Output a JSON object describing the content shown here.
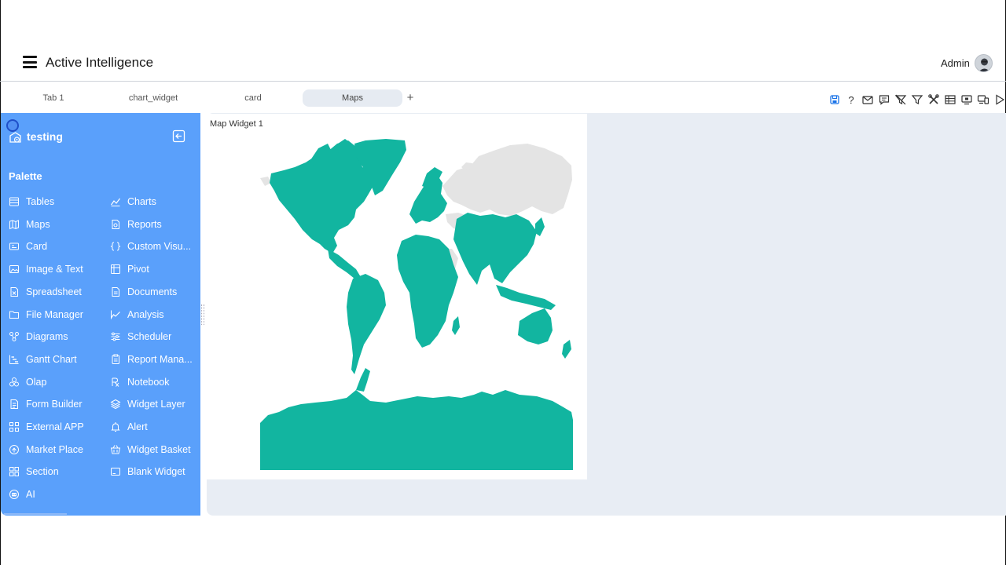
{
  "app": {
    "title": "Active Intelligence",
    "user": "Admin"
  },
  "tabs": [
    {
      "label": "Tab 1",
      "active": false
    },
    {
      "label": "chart_widget",
      "active": false
    },
    {
      "label": "card",
      "active": false
    },
    {
      "label": "Maps",
      "active": true
    }
  ],
  "tab_add_label": "+",
  "toolbar": {
    "icons": [
      "save-icon",
      "help-icon",
      "mail-icon",
      "comment-icon",
      "filter-clear-icon",
      "filter-icon",
      "tools-icon",
      "table-icon",
      "monitor-icon",
      "devices-icon",
      "play-icon"
    ],
    "help_glyph": "?"
  },
  "sidebar": {
    "workspace_name": "testing",
    "palette_title": "Palette",
    "items": [
      {
        "label": "Tables",
        "icon": "table-icon"
      },
      {
        "label": "Charts",
        "icon": "chart-icon"
      },
      {
        "label": "Maps",
        "icon": "map-icon"
      },
      {
        "label": "Reports",
        "icon": "report-icon"
      },
      {
        "label": "Card",
        "icon": "card-icon"
      },
      {
        "label": "Custom Visu...",
        "icon": "braces-icon"
      },
      {
        "label": "Image & Text",
        "icon": "image-icon"
      },
      {
        "label": "Pivot",
        "icon": "pivot-icon"
      },
      {
        "label": "Spreadsheet",
        "icon": "spreadsheet-icon"
      },
      {
        "label": "Documents",
        "icon": "document-icon"
      },
      {
        "label": "File Manager",
        "icon": "folder-icon"
      },
      {
        "label": "Analysis",
        "icon": "analysis-icon"
      },
      {
        "label": "Diagrams",
        "icon": "diagram-icon"
      },
      {
        "label": "Scheduler",
        "icon": "scheduler-icon"
      },
      {
        "label": "Gantt Chart",
        "icon": "gantt-icon"
      },
      {
        "label": "Report Mana...",
        "icon": "report-manager-icon"
      },
      {
        "label": "Olap",
        "icon": "olap-icon"
      },
      {
        "label": "Notebook",
        "icon": "notebook-icon"
      },
      {
        "label": "Form Builder",
        "icon": "form-icon"
      },
      {
        "label": "Widget Layer",
        "icon": "layers-icon"
      },
      {
        "label": "External APP",
        "icon": "apps-icon"
      },
      {
        "label": "Alert",
        "icon": "alert-icon"
      },
      {
        "label": "Market Place",
        "icon": "market-icon"
      },
      {
        "label": "Widget Basket",
        "icon": "basket-icon"
      },
      {
        "label": "Section",
        "icon": "section-icon"
      },
      {
        "label": "Blank Widget",
        "icon": "blank-widget-icon"
      },
      {
        "label": "AI",
        "icon": "ai-icon"
      }
    ]
  },
  "widget": {
    "title": "Map Widget 1",
    "colors": {
      "highlighted": "#12b5a0",
      "other": "#e4e4e4",
      "background": "#ffffff"
    }
  },
  "colors": {
    "sidebar": "#5aa0fb",
    "canvas": "#e8edf4",
    "accent": "#1a73e8"
  }
}
